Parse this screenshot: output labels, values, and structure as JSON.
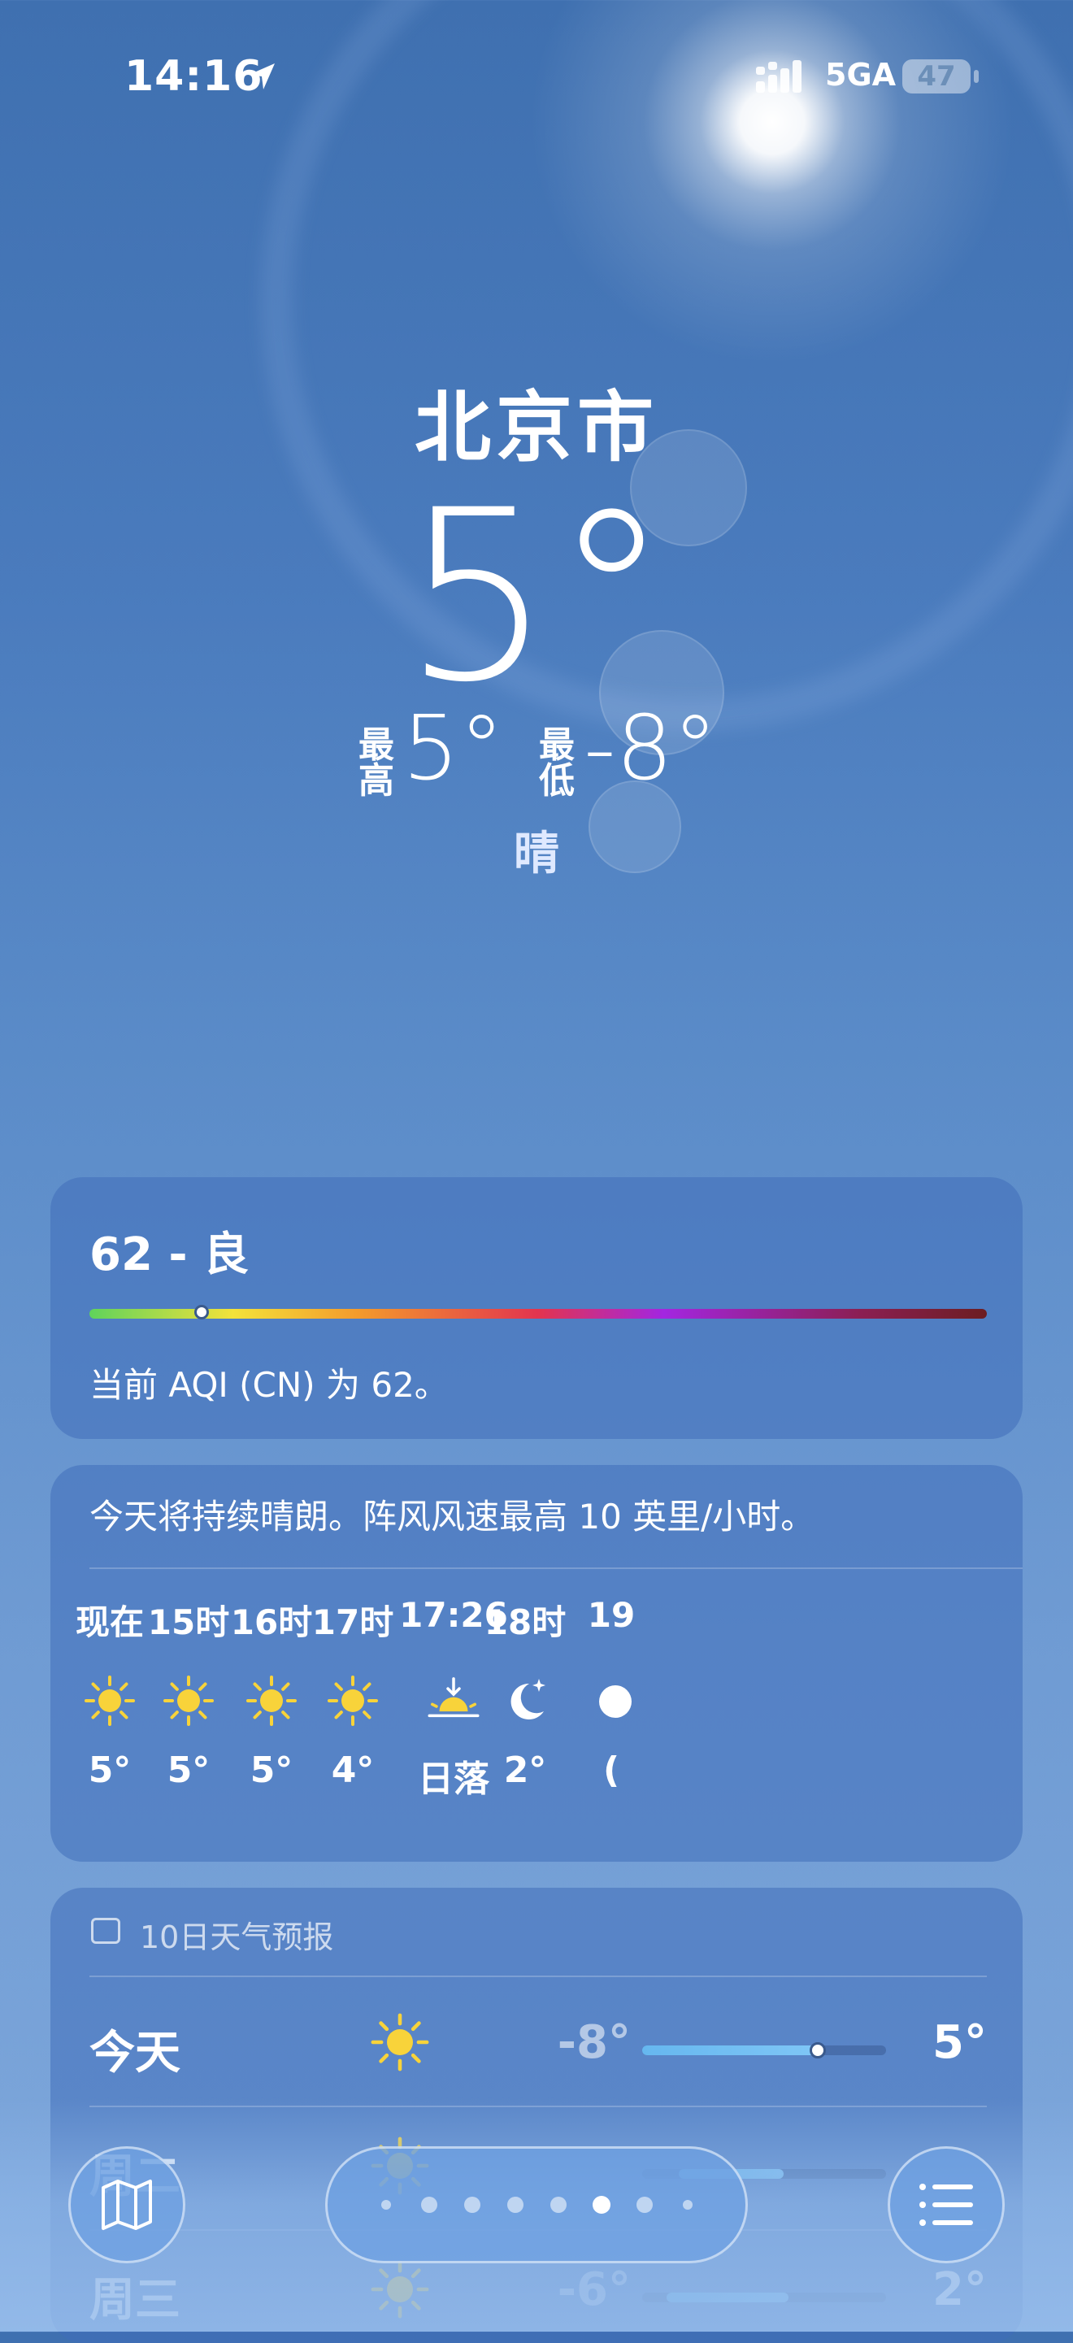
{
  "status_bar": {
    "time": "14:16",
    "carrier": "5GA",
    "battery": "47"
  },
  "weather": {
    "city": "北京市",
    "temperature": "5°",
    "high_label": "最高",
    "high": "5°",
    "low_label": "最低",
    "low": "-8°",
    "condition": "晴"
  },
  "aqi": {
    "value": "62 - 良",
    "description": "当前 AQI (CN) 为 62。",
    "position": 0.125
  },
  "hourly": {
    "summary": "今天将持续晴朗。阵风风速最高 10 英里/小时。",
    "items": [
      {
        "time": "现在",
        "icon": "sun-icon",
        "temp": "5°"
      },
      {
        "time": "15时",
        "icon": "sun-icon",
        "temp": "5°"
      },
      {
        "time": "16时",
        "icon": "sun-icon",
        "temp": "5°"
      },
      {
        "time": "17时",
        "icon": "sun-icon",
        "temp": "4°"
      },
      {
        "time": "17:26",
        "icon": "sunset-icon",
        "temp": "日落"
      },
      {
        "time": "18时",
        "icon": "moon-stars-icon",
        "temp": "2°"
      },
      {
        "time": "19",
        "icon": "moon-icon",
        "temp": "("
      }
    ]
  },
  "forecast": {
    "title": "10日天气预报",
    "days": [
      {
        "day": "今天",
        "icon": "sun-icon",
        "low": "-8°",
        "high": "5°",
        "range_start": 0.0,
        "range_end": 0.72,
        "current": 0.72
      },
      {
        "day": "周二",
        "icon": "sun-icon",
        "low": "",
        "high": "",
        "range_start": 0.15,
        "range_end": 0.58
      },
      {
        "day": "周三",
        "icon": "sun-icon",
        "low": "-6°",
        "high": "2°",
        "range_start": 0.1,
        "range_end": 0.6
      }
    ]
  },
  "pager": {
    "page_count": 8,
    "active_index": 5
  },
  "colors": {
    "sun": "#f8d33a",
    "bar_fill": "#6fbcf2"
  }
}
